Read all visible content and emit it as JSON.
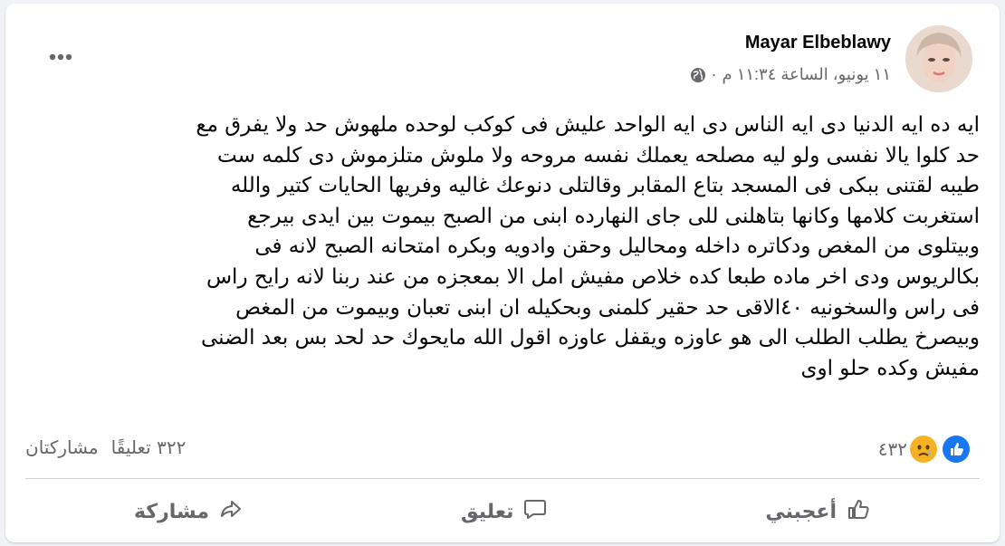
{
  "post": {
    "author": "Mayar Elbeblawy",
    "timestamp": "١١ يونيو، الساعة ١١:٣٤ م",
    "privacy_icon": "globe-icon",
    "privacy_separator": "·",
    "menu_icon": "more-horizontal-icon",
    "body_lines": [
      "ايه ده ايه الدنيا دى ايه الناس دى ايه  الواحد عليش فى كوكب لوحده ملهوش حد ولا يفرق مع",
      "حد كلوا يالا نفسى ولو ليه مصلحه يعملك نفسه مروحه ولا ملوش متلزموش دى كلمه ست",
      "طيبه لقتنى ببكى فى المسجد بتاع المقابر وقالتلى دنوعك غاليه  وفريها  الحايات كتير والله",
      "استغربت كلامها وكانها بتاهلنى للى جاى النهارده ابنى من الصبح بيموت بين ايدى بيرجع",
      "وبيتلوى من المغص ودكاتره داخله ومحاليل وحقن وادويه وبكره امتحانه الصبح لانه فى",
      "بكالريوس ودى اخر ماده طبعا كده خلاص مفيش امل الا بمعجزه من عند ربنا لانه رايح راس",
      "فى راس والسخونيه ٤٠الاقى حد حقير كلمنى وبحكيله ان ابنى تعبان وبيموت من المغص",
      "وبيصرخ يطلب الطلب الى هو عاوزه ويقفل  عاوزه اقول الله مايحوك حد لحد بس بعد الضنى",
      "مفيش  وكده حلو اوى"
    ]
  },
  "stats": {
    "reaction_icons": [
      "like-icon",
      "sad-icon"
    ],
    "reaction_count": "٤٣٢",
    "comments": "٣٢٢ تعليقًا",
    "shares": "مشاركتان"
  },
  "actions": {
    "like_label": "أعجبني",
    "comment_label": "تعليق",
    "share_label": "مشاركة"
  },
  "colors": {
    "secondary_text": "#65676b",
    "primary_text": "#050505",
    "like_blue": "#1877f2",
    "sad_yellow": "#f7b125"
  }
}
